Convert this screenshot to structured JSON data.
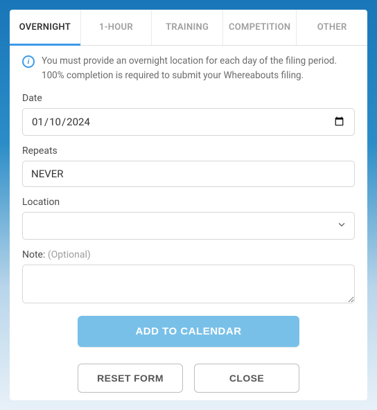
{
  "tabs": [
    {
      "label": "OVERNIGHT",
      "active": true
    },
    {
      "label": "1-HOUR",
      "active": false
    },
    {
      "label": "TRAINING",
      "active": false
    },
    {
      "label": "COMPETITION",
      "active": false
    },
    {
      "label": "OTHER",
      "active": false
    }
  ],
  "info_text": "You must provide an overnight location for each day of the filing period. 100% completion is required to submit your Whereabouts filing.",
  "fields": {
    "date": {
      "label": "Date",
      "value": "2024-01-10"
    },
    "repeats": {
      "label": "Repeats",
      "value": "NEVER"
    },
    "location": {
      "label": "Location",
      "value": ""
    },
    "note": {
      "label": "Note:",
      "optional": "(Optional)",
      "value": ""
    }
  },
  "buttons": {
    "add": "ADD TO CALENDAR",
    "reset": "RESET FORM",
    "close": "CLOSE"
  }
}
